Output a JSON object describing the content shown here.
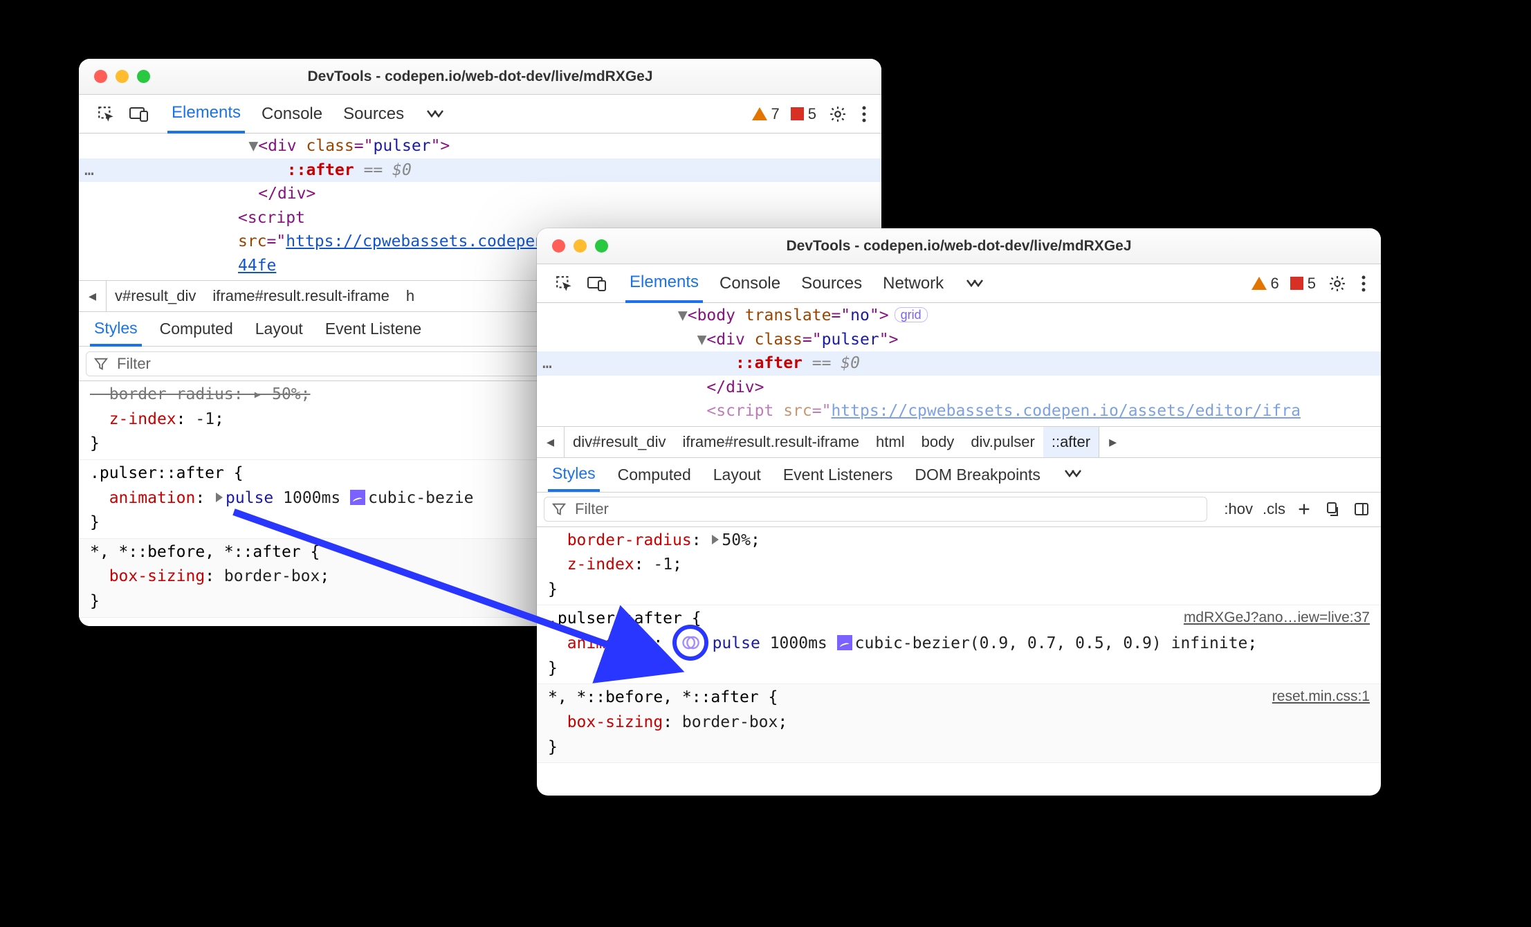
{
  "w1": {
    "title": "DevTools - codepen.io/web-dot-dev/live/mdRXGeJ",
    "tabs": {
      "t1": "Elements",
      "t2": "Console",
      "t3": "Sources"
    },
    "warn": "7",
    "err": "5",
    "dom": {
      "divOpen": "<div class=\"pulser\">",
      "after": "::after",
      "eq": " == ",
      "dollar": "$0",
      "divClose": "</div>",
      "scriptOpen": "<script src=\"",
      "scriptUrl": "https://cpwebassets.codepen.io/assets/editor/iframe/iframeRefreshCSS-44fe"
    },
    "crumbs": {
      "c1": "v#result_div",
      "c2": "iframe#result.result-iframe",
      "c3": "h"
    },
    "subtabs": {
      "s1": "Styles",
      "s2": "Computed",
      "s3": "Layout",
      "s4": "Event Listene"
    },
    "filter": "Filter",
    "css": {
      "r0l1": "border-radius: ▸ 50%;",
      "r0l2p": "z-index",
      "r0l2v": "-1",
      "sel1": ".pulser::after {",
      "anim_p": "animation",
      "anim_name": "pulse",
      "anim_dur": "1000ms",
      "anim_tail": "cubic-bezie",
      "sel2": "*, *::before, *::after {",
      "bs_p": "box-sizing",
      "bs_v": "border-box"
    }
  },
  "w2": {
    "title": "DevTools - codepen.io/web-dot-dev/live/mdRXGeJ",
    "tabs": {
      "t1": "Elements",
      "t2": "Console",
      "t3": "Sources",
      "t4": "Network"
    },
    "warn": "6",
    "err": "5",
    "dom": {
      "bodyOpen": "<body translate=\"no\">",
      "grid": "grid",
      "divOpen": "<div class=\"pulser\">",
      "after": "::after",
      "eq": " == ",
      "dollar": "$0",
      "divClose": "</div>",
      "scriptFrag": "<script src=\"https://cpwebassets.codepen.io/assets/editor/ifra"
    },
    "crumbs": {
      "c1": "div#result_div",
      "c2": "iframe#result.result-iframe",
      "c3": "html",
      "c4": "body",
      "c5": "div.pulser",
      "c6": "::after"
    },
    "subtabs": {
      "s1": "Styles",
      "s2": "Computed",
      "s3": "Layout",
      "s4": "Event Listeners",
      "s5": "DOM Breakpoints"
    },
    "filter": "Filter",
    "hov": ":hov",
    "cls": ".cls",
    "css": {
      "br_p": "border-radius",
      "br_v": "50%",
      "zi_p": "z-index",
      "zi_v": "-1",
      "src1": "mdRXGeJ?ano…iew=live:37",
      "sel1": ".pulser::after {",
      "anim_p": "animation",
      "anim_name": "pulse",
      "anim_dur": "1000ms",
      "anim_cb": "cubic-bezier(0.9, 0.7, 0.5, 0.9)",
      "anim_inf": "infinite",
      "src2": "reset.min.css:1",
      "sel2": "*, *::before, *::after {",
      "bs_p": "box-sizing",
      "bs_v": "border-box"
    }
  }
}
